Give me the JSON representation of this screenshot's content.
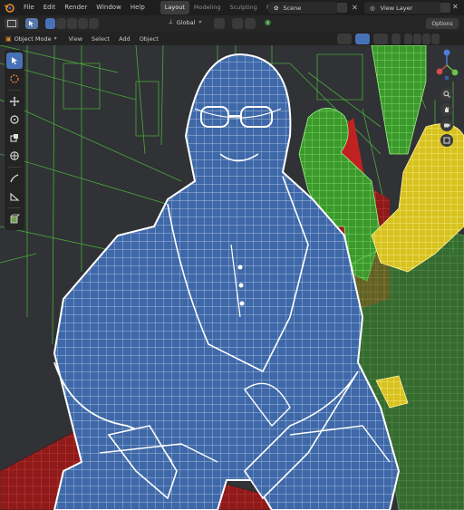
{
  "app": {
    "name": "Blender"
  },
  "menu": [
    "File",
    "Edit",
    "Render",
    "Window",
    "Help"
  ],
  "workspaces": [
    {
      "label": "Layout",
      "active": true
    },
    {
      "label": "Modeling",
      "active": false
    },
    {
      "label": "Sculpting",
      "active": false
    },
    {
      "label": "Rendering",
      "active": false
    }
  ],
  "scene": {
    "label": "Scene"
  },
  "view_layer": {
    "label": "View Layer"
  },
  "header": {
    "transform_orientation": "Global",
    "options_label": "Options"
  },
  "viewport_menu": {
    "mode": "Object Mode",
    "items": [
      "View",
      "Select",
      "Add",
      "Object"
    ]
  },
  "tools": [
    {
      "name": "select-box",
      "icon": "cursor-icon",
      "active": true
    },
    {
      "name": "cursor",
      "icon": "3d-cursor-icon",
      "active": false
    },
    {
      "name": "move",
      "icon": "move-icon",
      "active": false
    },
    {
      "name": "rotate",
      "icon": "rotate-icon",
      "active": false
    },
    {
      "name": "scale",
      "icon": "scale-icon",
      "active": false
    },
    {
      "name": "transform",
      "icon": "transform-icon",
      "active": false
    },
    {
      "name": "annotate",
      "icon": "annotate-icon",
      "active": false
    },
    {
      "name": "measure",
      "icon": "measure-icon",
      "active": false
    },
    {
      "name": "add-cube",
      "icon": "add-cube-icon",
      "active": false
    }
  ],
  "colors": {
    "wire_selected": "#ffffff",
    "mesh_blue": "#3e68a8",
    "mesh_green": "#52c23a",
    "mesh_yellow": "#e5d027",
    "mesh_red": "#a51d1d",
    "scene_lines": "#4fbf3a",
    "accent": "#4872b8"
  }
}
